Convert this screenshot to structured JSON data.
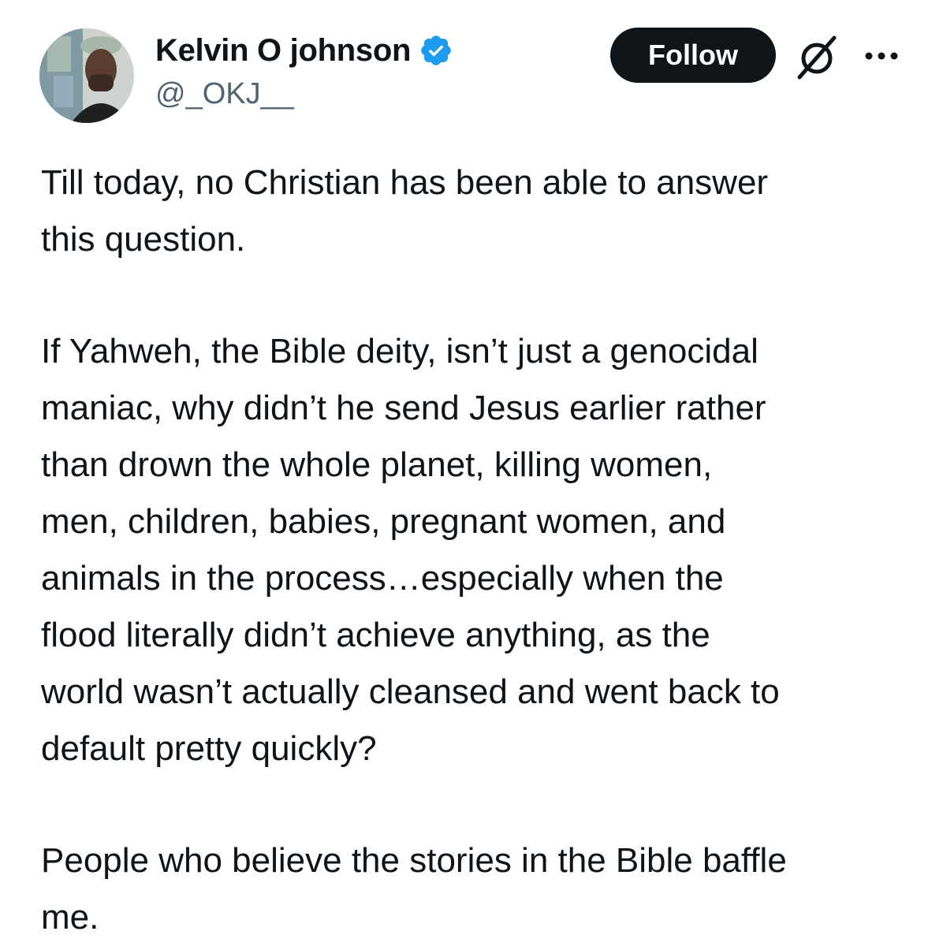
{
  "author": {
    "display_name": "Kelvin O johnson",
    "handle": "@_OKJ__",
    "verified": true,
    "verified_color": "#1d9bf0"
  },
  "actions": {
    "follow_label": "Follow",
    "grok_icon": "grok-icon",
    "more_icon": "more-options-icon"
  },
  "tweet": {
    "paragraphs": [
      "Till today, no Christian has been able to answer\nthis question.",
      "If Yahweh, the Bible deity, isn’t just a genocidal\nmaniac, why didn’t he send Jesus earlier rather\nthan drown the whole planet, killing women,\nmen, children, babies, pregnant women, and\nanimals in the process…especially when the\nflood literally didn’t achieve anything, as the\nworld wasn’t actually cleansed and went back to\ndefault pretty quickly?",
      "People who believe the stories in the Bible baffle\nme."
    ]
  },
  "colors": {
    "text": "#0f1419",
    "secondary_text": "#536471",
    "button_bg": "#0f1419",
    "button_text": "#ffffff"
  }
}
